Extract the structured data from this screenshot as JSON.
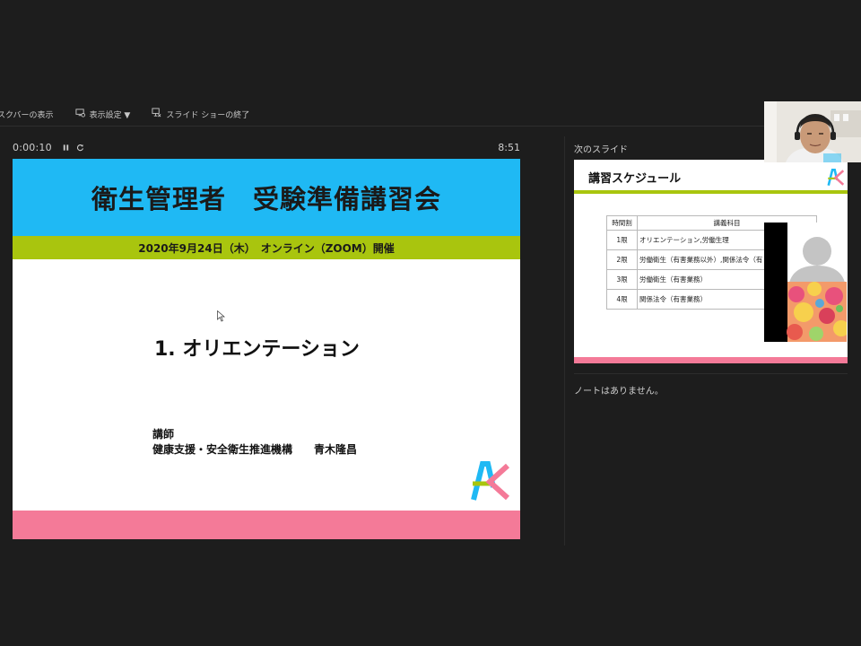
{
  "toolbar": {
    "items": [
      {
        "label": "タスクバーの表示"
      },
      {
        "label": "表示設定 ▼"
      },
      {
        "label": "スライド ショーの終了"
      }
    ]
  },
  "presenter": {
    "elapsed": "0:00:10",
    "clock": "8:51",
    "next_label": "次のスライド",
    "notes": "ノートはありません。"
  },
  "current_slide": {
    "title": "衛生管理者　受験準備講習会",
    "subtitle": "2020年9月24日（木）　オンライン（ZOOM）開催",
    "section": "1. オリエンテーション",
    "lecturer_label": "講師",
    "lecturer": "健康支援・安全衛生推進機構　　青木隆昌",
    "colors": {
      "header": "#1fb9f4",
      "band": "#a9c50e",
      "footer": "#f47a98"
    }
  },
  "next_slide": {
    "title": "講習スケジュール",
    "headers": [
      "時間割",
      "講義科目"
    ],
    "rows": [
      [
        "1限",
        "オリエンテーション,労働生理"
      ],
      [
        "2限",
        "労働衛生（有害業務以外）,関係法令（有"
      ],
      [
        "3限",
        "労働衛生（有害業務）"
      ],
      [
        "4限",
        "関係法令（有害業務）"
      ]
    ]
  }
}
